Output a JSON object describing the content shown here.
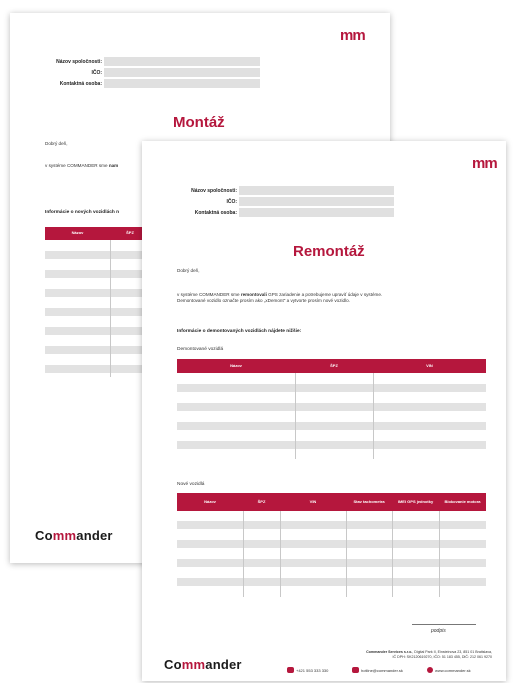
{
  "back": {
    "logo": "mm",
    "fields": [
      "Názov spoločnosti:",
      "IČO:",
      "Kontaktná osoba:"
    ],
    "title": "Montáž",
    "greeting": "Dobrý deň,",
    "body_prefix": "v systéme COMMANDER sme ",
    "body_bold": "nam",
    "section": "Informácie o nových vozidlách n",
    "table_headers": [
      "Názov",
      "ŠPZ"
    ],
    "brand_pre": "Co",
    "brand_mm": "mm",
    "brand_post": "ander"
  },
  "front": {
    "logo": "mm",
    "fields": [
      "Názov spoločnosti:",
      "IČO:",
      "Kontaktná osoba:"
    ],
    "title": "Remontáž",
    "greeting": "Dobrý deň,",
    "body_prefix": "v systéme COMMANDER sme ",
    "body_bold": "remontovali",
    "body_suffix": " GPS zariadenie a potrebujeme upraviť údaje v systéme.",
    "body_line2": "Demontované vozidlo označte prosím ako „xDemont\" a vytvorte prosím nové vozidlo.",
    "section": "Informácie o demontovaných vozidlách nájdete nižšie:",
    "subheading1": "Demontované vozidlá",
    "table1_headers": [
      "Názov",
      "ŠPZ",
      "VIN"
    ],
    "subheading2": "Nové vozidlá",
    "table2_headers": [
      "Názov",
      "ŠPZ",
      "VIN",
      "Stav tachometra",
      "IMEI GPS jednotky",
      "Blokovanie motora"
    ],
    "signature_label": "podpis",
    "brand_pre": "Co",
    "brand_mm": "mm",
    "brand_post": "ander",
    "footer_line1_bold": "Commander Services s.r.o.",
    "footer_line1_rest": ", Digital Park II, Einsteinova 23, 851 01 Bratislava,",
    "footer_line2": "IČ DPH: SK2120619270, IČO: 51 183 455, DIČ: 212 061 9270",
    "phone": "+421 553 333 330",
    "email": "hotline@commander.sk",
    "web": "www.commander.sk"
  },
  "colors": {
    "accent": "#b5173d",
    "row_fill": "#e2e2e2",
    "field_fill": "#e0e0e0"
  }
}
